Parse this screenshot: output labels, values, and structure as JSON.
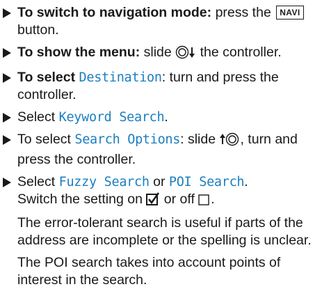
{
  "steps": [
    {
      "lead": "To switch to navigation mode:",
      "t1": " press the ",
      "key": "NAVI",
      "t2": " button."
    },
    {
      "lead": "To show the menu:",
      "t1": " slide ",
      "t2": " the controller."
    },
    {
      "lead": "To select ",
      "ui": "Destination",
      "t1": ": turn and press the controller."
    },
    {
      "t1": "Select ",
      "ui": "Keyword Search",
      "t2": "."
    },
    {
      "t1": "To select ",
      "ui": "Search Options",
      "t2": ": slide ",
      "t3": ", turn and press the controller."
    },
    {
      "t1": "Select ",
      "ui1": "Fuzzy Search",
      "t2": " or ",
      "ui2": "POI Search",
      "t3": ".",
      "t4": "Switch the setting on ",
      "t5": " or off ",
      "t6": "."
    }
  ],
  "notes": [
    "The error-tolerant search is useful if parts of the address are incomplete or the spelling is unclear.",
    "The POI search takes into account points of interest in the search."
  ],
  "icons": {
    "bullet": "right-triangle-bullet",
    "controller_down": "controller-slide-down-icon",
    "controller_up": "controller-slide-up-icon",
    "checkbox_on": "checkbox-checked-icon",
    "checkbox_off": "checkbox-empty-icon"
  },
  "colors": {
    "text": "#1a1a1a",
    "ui_term": "#1b7fc0"
  }
}
